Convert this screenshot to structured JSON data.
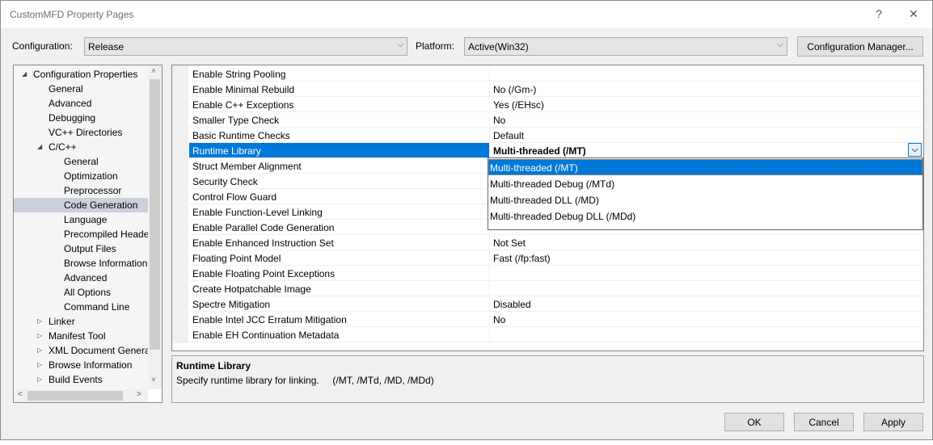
{
  "window": {
    "title": "CustomMFD Property Pages",
    "help_glyph": "?",
    "close_glyph": "✕"
  },
  "toolbar": {
    "configuration_label": "Configuration:",
    "configuration_value": "Release",
    "platform_label": "Platform:",
    "platform_value": "Active(Win32)",
    "config_manager_label": "Configuration Manager...",
    "chevron_glyph": "⌵"
  },
  "tree": {
    "items": [
      {
        "label": "Configuration Properties",
        "level": 0,
        "expander": "◢"
      },
      {
        "label": "General",
        "level": 1,
        "expander": ""
      },
      {
        "label": "Advanced",
        "level": 1,
        "expander": ""
      },
      {
        "label": "Debugging",
        "level": 1,
        "expander": ""
      },
      {
        "label": "VC++ Directories",
        "level": 1,
        "expander": ""
      },
      {
        "label": "C/C++",
        "level": 1,
        "expander": "◢"
      },
      {
        "label": "General",
        "level": 2,
        "expander": ""
      },
      {
        "label": "Optimization",
        "level": 2,
        "expander": ""
      },
      {
        "label": "Preprocessor",
        "level": 2,
        "expander": ""
      },
      {
        "label": "Code Generation",
        "level": 2,
        "expander": "",
        "selected": true
      },
      {
        "label": "Language",
        "level": 2,
        "expander": ""
      },
      {
        "label": "Precompiled Headers",
        "level": 2,
        "expander": ""
      },
      {
        "label": "Output Files",
        "level": 2,
        "expander": ""
      },
      {
        "label": "Browse Information",
        "level": 2,
        "expander": ""
      },
      {
        "label": "Advanced",
        "level": 2,
        "expander": ""
      },
      {
        "label": "All Options",
        "level": 2,
        "expander": ""
      },
      {
        "label": "Command Line",
        "level": 2,
        "expander": ""
      },
      {
        "label": "Linker",
        "level": 1,
        "expander": "▷"
      },
      {
        "label": "Manifest Tool",
        "level": 1,
        "expander": "▷"
      },
      {
        "label": "XML Document Generator",
        "level": 1,
        "expander": "▷"
      },
      {
        "label": "Browse Information",
        "level": 1,
        "expander": "▷"
      },
      {
        "label": "Build Events",
        "level": 1,
        "expander": "▷"
      }
    ],
    "scroll_up": "˄",
    "scroll_down": "˅",
    "scroll_left": "<",
    "scroll_right": ">"
  },
  "properties": {
    "rows": [
      {
        "name": "Enable String Pooling",
        "value": ""
      },
      {
        "name": "Enable Minimal Rebuild",
        "value": "No (/Gm-)"
      },
      {
        "name": "Enable C++ Exceptions",
        "value": "Yes (/EHsc)"
      },
      {
        "name": "Smaller Type Check",
        "value": "No"
      },
      {
        "name": "Basic Runtime Checks",
        "value": "Default"
      },
      {
        "name": "Runtime Library",
        "value": "Multi-threaded (/MT)",
        "selected": true
      },
      {
        "name": "Struct Member Alignment",
        "value": ""
      },
      {
        "name": "Security Check",
        "value": ""
      },
      {
        "name": "Control Flow Guard",
        "value": ""
      },
      {
        "name": "Enable Function-Level Linking",
        "value": ""
      },
      {
        "name": "Enable Parallel Code Generation",
        "value": ""
      },
      {
        "name": "Enable Enhanced Instruction Set",
        "value": "Not Set"
      },
      {
        "name": "Floating Point Model",
        "value": "Fast (/fp:fast)"
      },
      {
        "name": "Enable Floating Point Exceptions",
        "value": ""
      },
      {
        "name": "Create Hotpatchable Image",
        "value": ""
      },
      {
        "name": "Spectre Mitigation",
        "value": "Disabled"
      },
      {
        "name": "Enable Intel JCC Erratum Mitigation",
        "value": "No"
      },
      {
        "name": "Enable EH Continuation Metadata",
        "value": ""
      }
    ],
    "dropdown_options": [
      {
        "label": "Multi-threaded (/MT)",
        "selected": true
      },
      {
        "label": "Multi-threaded Debug (/MTd)"
      },
      {
        "label": "Multi-threaded DLL (/MD)"
      },
      {
        "label": "Multi-threaded Debug DLL (/MDd)"
      }
    ]
  },
  "description": {
    "title": "Runtime Library",
    "text": "Specify runtime library for linking.     (/MT, /MTd, /MD, /MDd)"
  },
  "buttons": {
    "ok": "OK",
    "cancel": "Cancel",
    "apply": "Apply"
  }
}
